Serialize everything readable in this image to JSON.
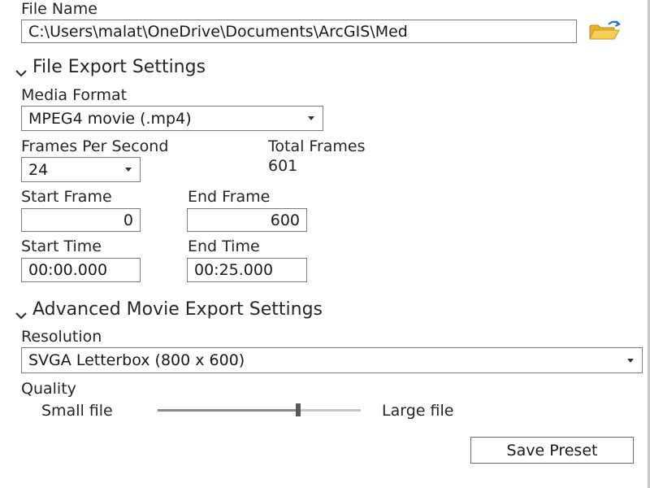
{
  "file_name": {
    "label": "File Name",
    "value": "C:\\Users\\malat\\OneDrive\\Documents\\ArcGIS\\Med"
  },
  "file_export": {
    "header": "File Export Settings",
    "media_format_label": "Media Format",
    "media_format_value": "MPEG4 movie (.mp4)",
    "fps_label": "Frames Per Second",
    "fps_value": "24",
    "total_frames_label": "Total Frames",
    "total_frames_value": "601",
    "start_frame_label": "Start Frame",
    "start_frame_value": "0",
    "end_frame_label": "End Frame",
    "end_frame_value": "600",
    "start_time_label": "Start Time",
    "start_time_value": "00:00.000",
    "end_time_label": "End Time",
    "end_time_value": "00:25.000"
  },
  "advanced": {
    "header": "Advanced Movie Export Settings",
    "resolution_label": "Resolution",
    "resolution_value": "SVGA Letterbox (800 x 600)",
    "quality_label": "Quality",
    "quality_min_label": "Small file",
    "quality_max_label": "Large file",
    "quality_level": 0.69
  },
  "save_preset_label": "Save Preset",
  "icons": {
    "folder": "open-folder-icon",
    "chevron": "chevron-down-icon"
  },
  "colors": {
    "folder_yellow": "#f2c343",
    "folder_blue": "#2a73c9"
  }
}
